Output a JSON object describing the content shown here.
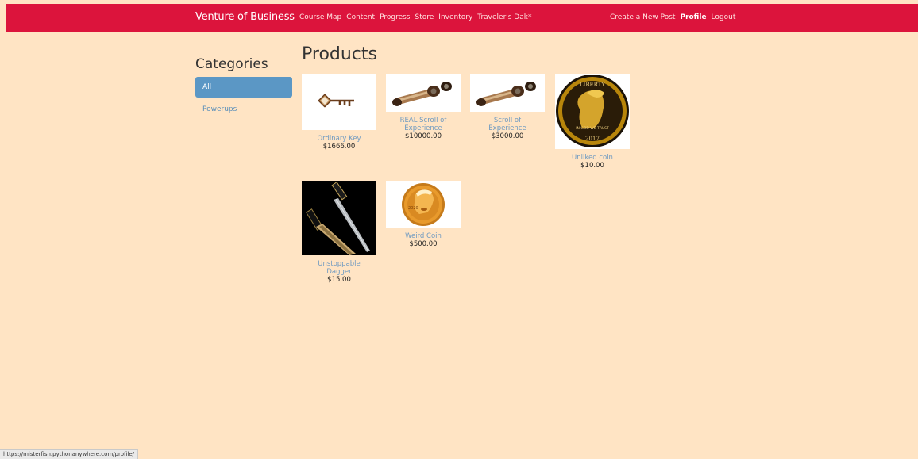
{
  "navbar": {
    "brand": "Venture of Business",
    "left_links": [
      "Course Map",
      "Content",
      "Progress",
      "Store",
      "Inventory",
      "Traveler's Dak*"
    ],
    "right_links": [
      "Create a New Post",
      "Profile",
      "Logout"
    ],
    "active_link": "Profile",
    "color": "#dc143c"
  },
  "sidebar": {
    "title": "Categories",
    "items": [
      {
        "label": "All",
        "active": true
      },
      {
        "label": "Powerups",
        "active": false
      }
    ]
  },
  "main": {
    "title": "Products",
    "products": [
      {
        "name": "Ordinary Key",
        "price": "$1666.00",
        "icon": "key-icon"
      },
      {
        "name": "REAL Scroll of Experience",
        "price": "$10000.00",
        "icon": "scroll-icon"
      },
      {
        "name": "Scroll of Experience",
        "price": "$3000.00",
        "icon": "scroll-icon"
      },
      {
        "name": "Unliked coin",
        "price": "$10.00",
        "icon": "gold-coin-icon"
      },
      {
        "name": "Unstoppable Dagger",
        "price": "$15.00",
        "icon": "dagger-icon"
      },
      {
        "name": "Weird Coin",
        "price": "$500.00",
        "icon": "gold-coin-icon"
      }
    ],
    "coin_text": {
      "liberty": "LIBERTY",
      "motto": "IN GOD WE TRUST",
      "year": "2017",
      "weird_year": "2020"
    }
  },
  "status_bar": {
    "url": "https://misterfish.pythonanywhere.com/profile/"
  },
  "colors": {
    "background": "#ffe4c4",
    "accent": "#dc143c",
    "link": "#6f9ac1",
    "active_category": "#5b97c5"
  }
}
